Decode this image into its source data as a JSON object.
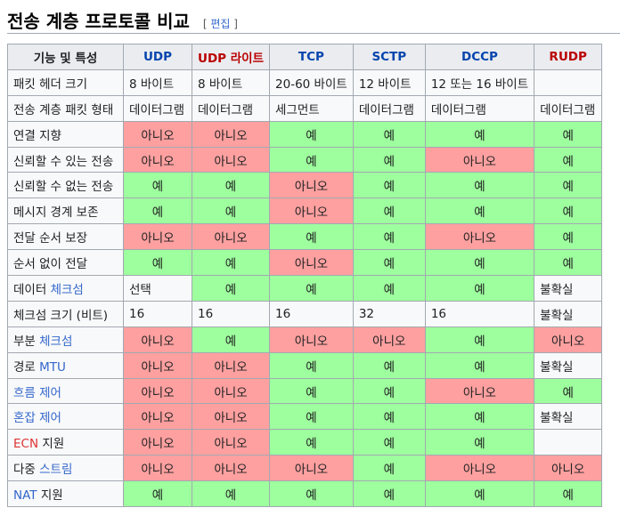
{
  "section": {
    "title": "전송 계층 프로토콜 비교",
    "edit_open": "[ ",
    "edit_label": "편집",
    "edit_close": " ]"
  },
  "colors": {
    "yes": "#9eff9e",
    "no": "#ffa0a0",
    "link": "#3366cc",
    "redlink": "#dd3333"
  },
  "table": {
    "header": {
      "feature": "기능 및 특성",
      "udp": "UDP",
      "udpl": "UDP 라이트",
      "tcp": "TCP",
      "sctp": "SCTP",
      "dccp": "DCCP",
      "rudp": "RUDP"
    },
    "rows": [
      {
        "label": "패킷 헤더 크기",
        "cells": [
          "8 바이트",
          "8 바이트",
          "20-60 바이트",
          "12 바이트",
          "12 또는 16 바이트",
          ""
        ]
      },
      {
        "label": "전송 계층 패킷 형태",
        "cells": [
          "데이터그램",
          "데이터그램",
          "세그먼트",
          "데이터그램",
          "데이터그램",
          "데이터그램"
        ]
      },
      {
        "label": "연결 지향",
        "cells": [
          "아니오",
          "아니오",
          "예",
          "예",
          "예",
          "예"
        ]
      },
      {
        "label": "신뢰할 수 있는 전송",
        "cells": [
          "아니오",
          "아니오",
          "예",
          "예",
          "아니오",
          "예"
        ]
      },
      {
        "label": "신뢰할 수 없는 전송",
        "cells": [
          "예",
          "예",
          "아니오",
          "예",
          "예",
          "예"
        ]
      },
      {
        "label": "메시지 경계 보존",
        "cells": [
          "예",
          "예",
          "아니오",
          "예",
          "예",
          "예"
        ]
      },
      {
        "label": "전달 순서 보장",
        "cells": [
          "아니오",
          "아니오",
          "예",
          "예",
          "아니오",
          "예"
        ]
      },
      {
        "label": "순서 없이 전달",
        "cells": [
          "예",
          "예",
          "아니오",
          "예",
          "예",
          "예"
        ]
      },
      {
        "label_pre": "데이터 ",
        "label_link": "체크섬",
        "cells": [
          "선택",
          "예",
          "예",
          "예",
          "예",
          "불확실"
        ]
      },
      {
        "label": "체크섬 크기 (비트)",
        "cells": [
          "16",
          "16",
          "16",
          "32",
          "16",
          "불확실"
        ]
      },
      {
        "label_pre": "부분 ",
        "label_link": "체크섬",
        "cells": [
          "아니오",
          "예",
          "아니오",
          "아니오",
          "예",
          "아니오"
        ]
      },
      {
        "label_pre": "경로 ",
        "label_link": "MTU",
        "cells": [
          "아니오",
          "아니오",
          "예",
          "예",
          "예",
          "불확실"
        ]
      },
      {
        "label_link": "흐름 제어",
        "cells": [
          "아니오",
          "아니오",
          "예",
          "예",
          "아니오",
          "예"
        ]
      },
      {
        "label_link": "혼잡 제어",
        "cells": [
          "아니오",
          "아니오",
          "예",
          "예",
          "예",
          "불확실"
        ]
      },
      {
        "label_red": "ECN",
        "label_post": " 지원",
        "cells": [
          "아니오",
          "아니오",
          "예",
          "예",
          "예",
          ""
        ]
      },
      {
        "label_pre": "다중 ",
        "label_link": "스트림",
        "cells": [
          "아니오",
          "아니오",
          "아니오",
          "예",
          "아니오",
          "아니오"
        ]
      },
      {
        "label_link": "NAT",
        "label_post": " 지원",
        "cells": [
          "예",
          "예",
          "예",
          "예",
          "예",
          "예"
        ]
      }
    ]
  }
}
